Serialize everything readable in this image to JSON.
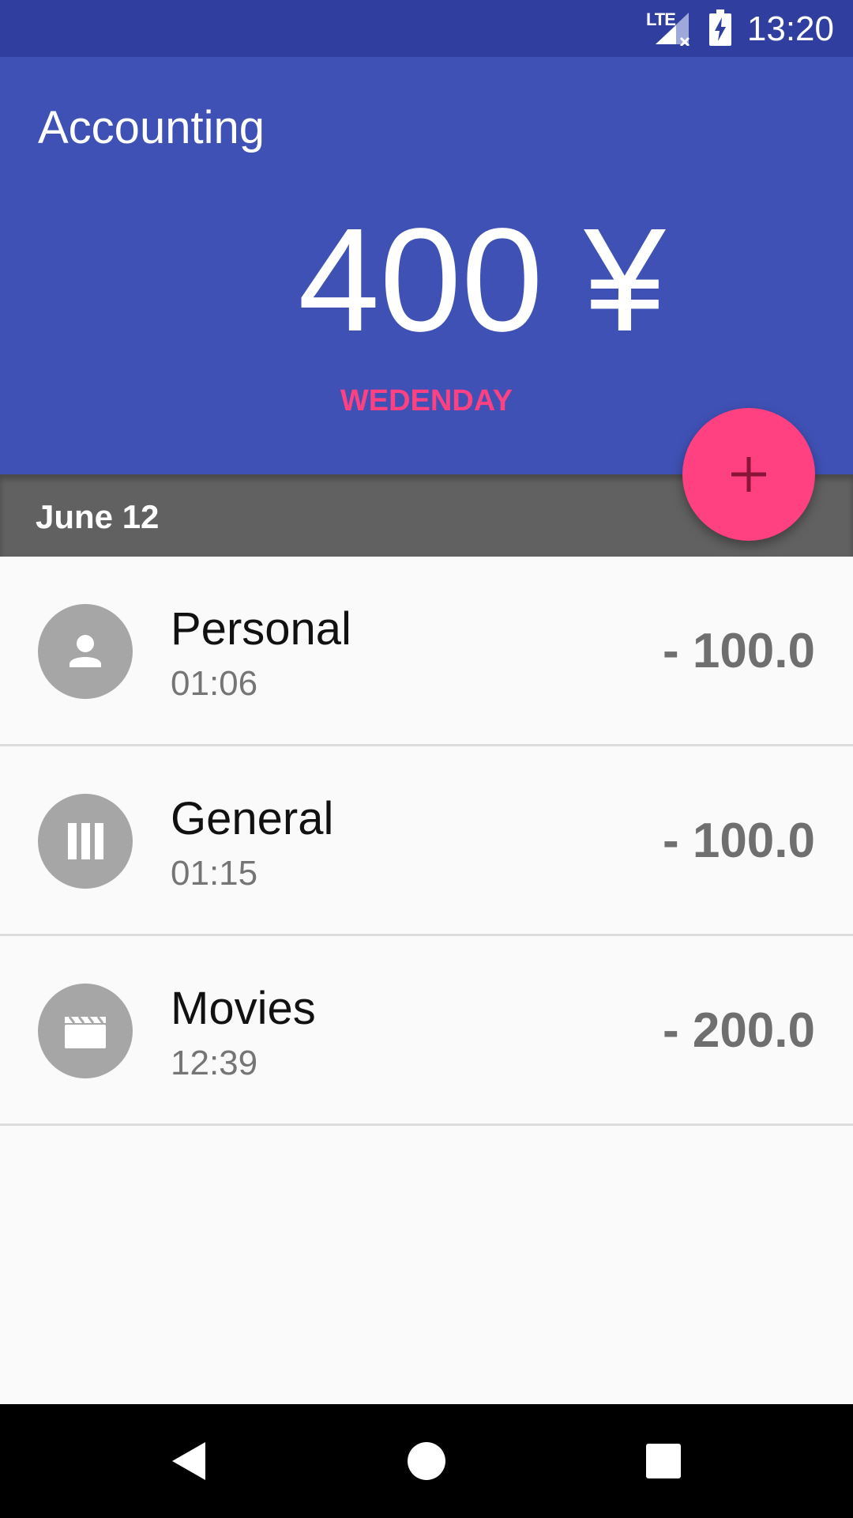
{
  "status_bar": {
    "network": "LTE",
    "time": "13:20"
  },
  "header": {
    "title": "Accounting",
    "total": "400 ¥",
    "day": "WEDENDAY"
  },
  "date_section": {
    "label": "June 12"
  },
  "entries": [
    {
      "category": "Personal",
      "time": "01:06",
      "amount": "- 100.0",
      "icon": "person-icon"
    },
    {
      "category": "General",
      "time": "01:15",
      "amount": "- 100.0",
      "icon": "bars-icon"
    },
    {
      "category": "Movies",
      "time": "12:39",
      "amount": "- 200.0",
      "icon": "clapperboard-icon"
    }
  ],
  "colors": {
    "primary": "#3f51b5",
    "primary_dark": "#303f9f",
    "accent": "#ff4081",
    "date_header": "#616161"
  },
  "icons": {
    "fab": "plus-icon",
    "nav_back": "back-triangle-icon",
    "nav_home": "home-circle-icon",
    "nav_recents": "recents-square-icon"
  }
}
